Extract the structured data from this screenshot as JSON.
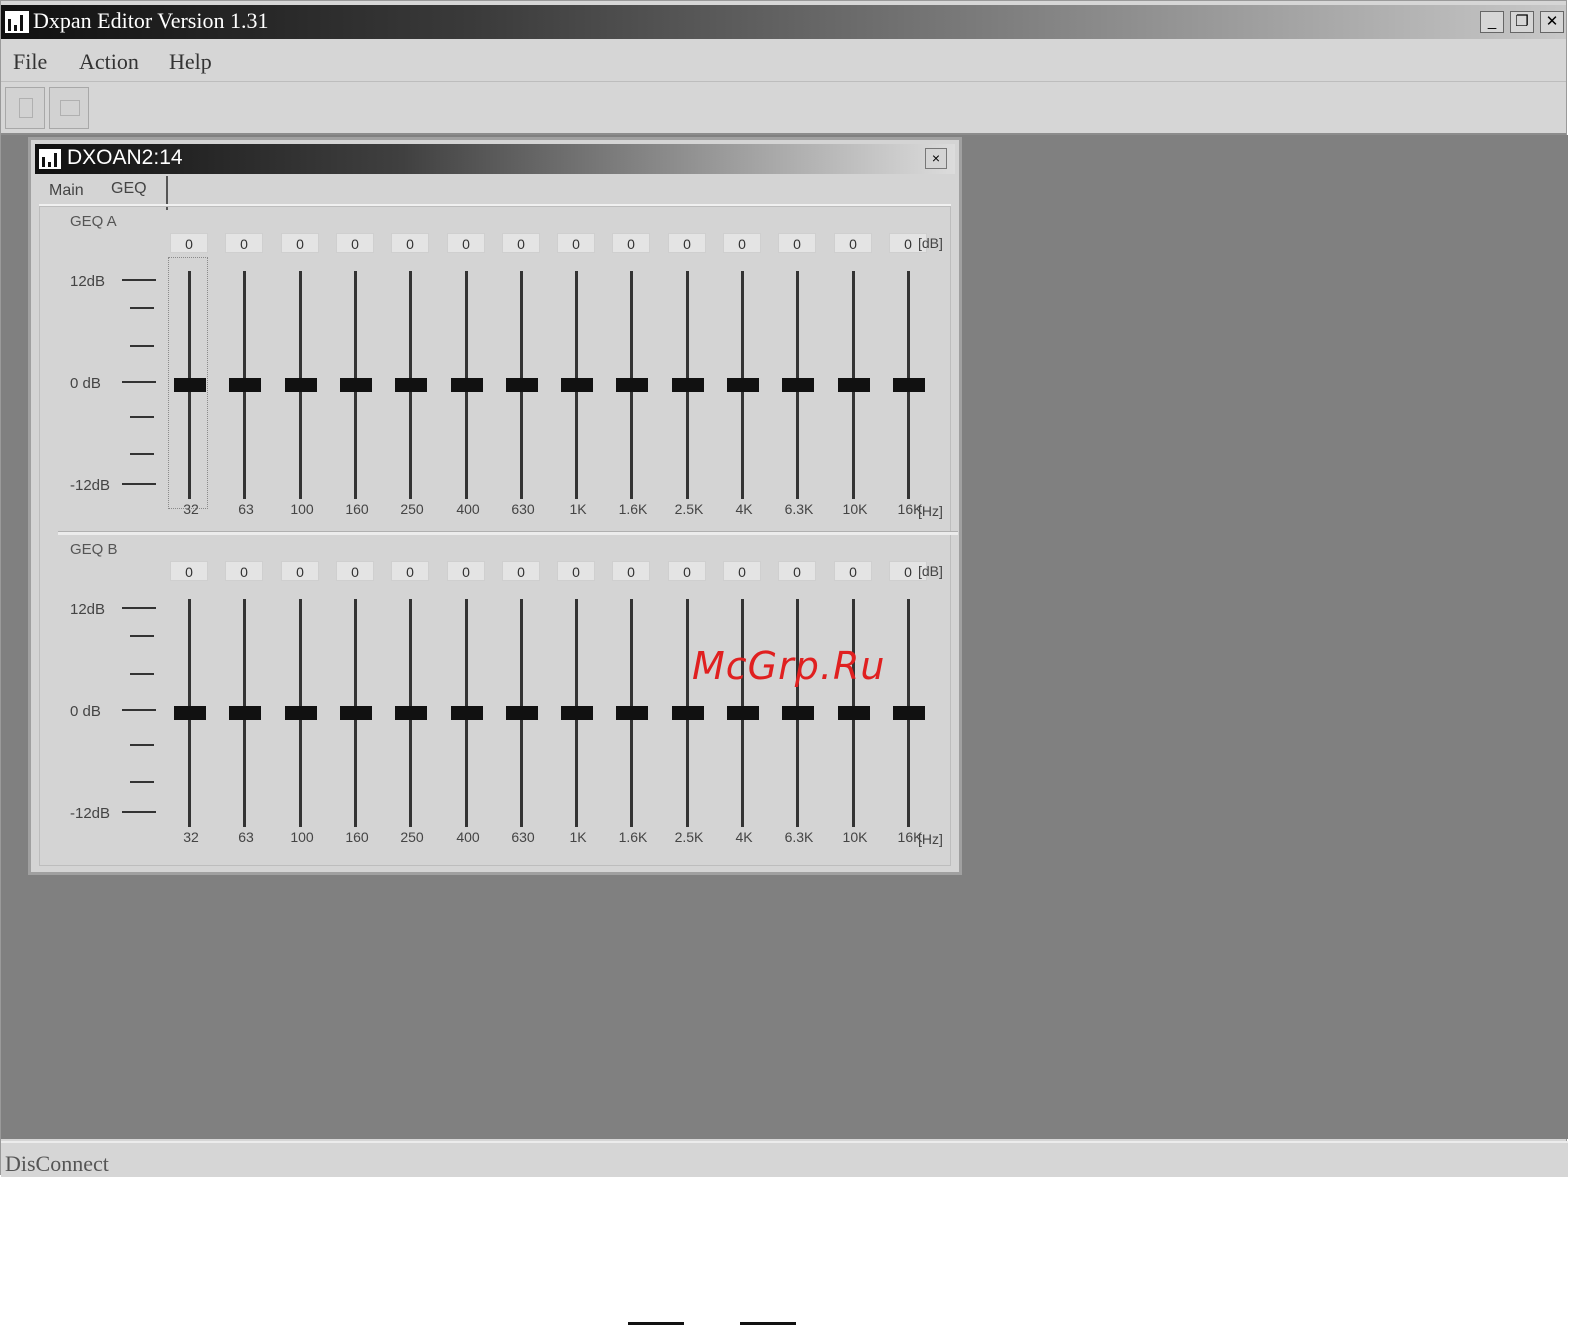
{
  "app": {
    "title": "Dxpan Editor Version 1.31",
    "menu": [
      "File",
      "Action",
      "Help"
    ],
    "status": "DisConnect"
  },
  "child": {
    "title": "DXOAN2:14",
    "close_glyph": "×",
    "tabs": [
      "Main",
      "GEQ"
    ],
    "active_tab": "GEQ"
  },
  "geq_sections": [
    {
      "title": "GEQ A",
      "db_labels": [
        "12dB",
        "0 dB",
        "-12dB"
      ],
      "unit_db": "[dB]",
      "unit_hz": "[Hz]",
      "bands": [
        {
          "freq": "32",
          "value": "0"
        },
        {
          "freq": "63",
          "value": "0"
        },
        {
          "freq": "100",
          "value": "0"
        },
        {
          "freq": "160",
          "value": "0"
        },
        {
          "freq": "250",
          "value": "0"
        },
        {
          "freq": "400",
          "value": "0"
        },
        {
          "freq": "630",
          "value": "0"
        },
        {
          "freq": "1K",
          "value": "0"
        },
        {
          "freq": "1.6K",
          "value": "0"
        },
        {
          "freq": "2.5K",
          "value": "0"
        },
        {
          "freq": "4K",
          "value": "0"
        },
        {
          "freq": "6.3K",
          "value": "0"
        },
        {
          "freq": "10K",
          "value": "0"
        },
        {
          "freq": "16K",
          "value": "0"
        }
      ]
    },
    {
      "title": "GEQ B",
      "db_labels": [
        "12dB",
        "0 dB",
        "-12dB"
      ],
      "unit_db": "[dB]",
      "unit_hz": "[Hz]",
      "bands": [
        {
          "freq": "32",
          "value": "0"
        },
        {
          "freq": "63",
          "value": "0"
        },
        {
          "freq": "100",
          "value": "0"
        },
        {
          "freq": "160",
          "value": "0"
        },
        {
          "freq": "250",
          "value": "0"
        },
        {
          "freq": "400",
          "value": "0"
        },
        {
          "freq": "630",
          "value": "0"
        },
        {
          "freq": "1K",
          "value": "0"
        },
        {
          "freq": "1.6K",
          "value": "0"
        },
        {
          "freq": "2.5K",
          "value": "0"
        },
        {
          "freq": "4K",
          "value": "0"
        },
        {
          "freq": "6.3K",
          "value": "0"
        },
        {
          "freq": "10K",
          "value": "0"
        },
        {
          "freq": "16K",
          "value": "0"
        }
      ]
    }
  ],
  "watermark": "McGrp.Ru"
}
